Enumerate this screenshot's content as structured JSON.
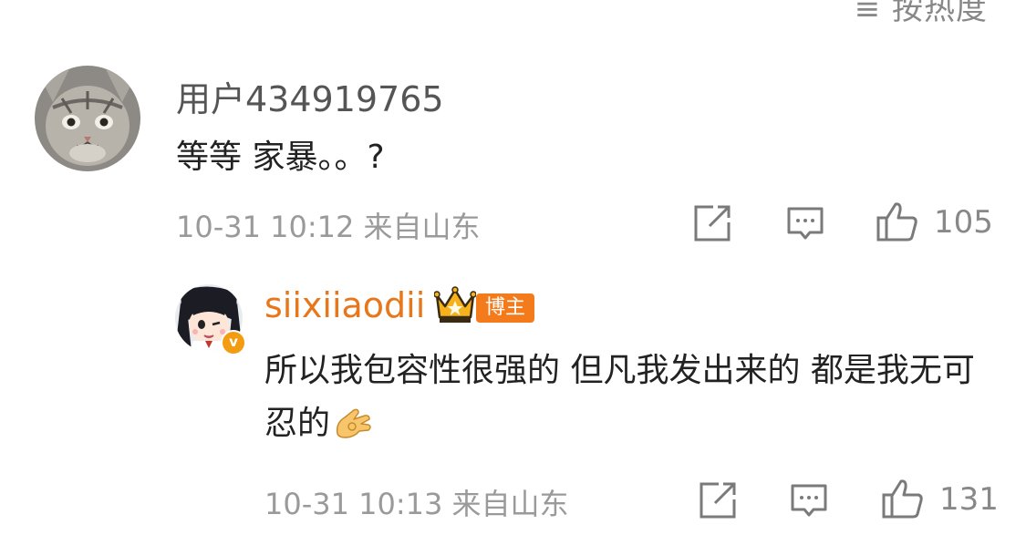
{
  "sort_label": "≡ 按热度",
  "comments": [
    {
      "username": "用户434919765",
      "content": "等等 家暴。。?",
      "timestamp": "10-31 10:12",
      "location": "来自山东",
      "like_count": "105",
      "avatar_icon": "cat-avatar"
    }
  ],
  "reply": {
    "username": "siixiiaodii",
    "badge": "博主",
    "content": "所以我包容性很强的 但凡我发出来的 都是我无可忍的",
    "timestamp": "10-31 10:13",
    "location": "来自山东",
    "like_count": "131",
    "verified_mark": "v",
    "username_color": "#e8761b",
    "badge_color": "#f47b1c"
  }
}
